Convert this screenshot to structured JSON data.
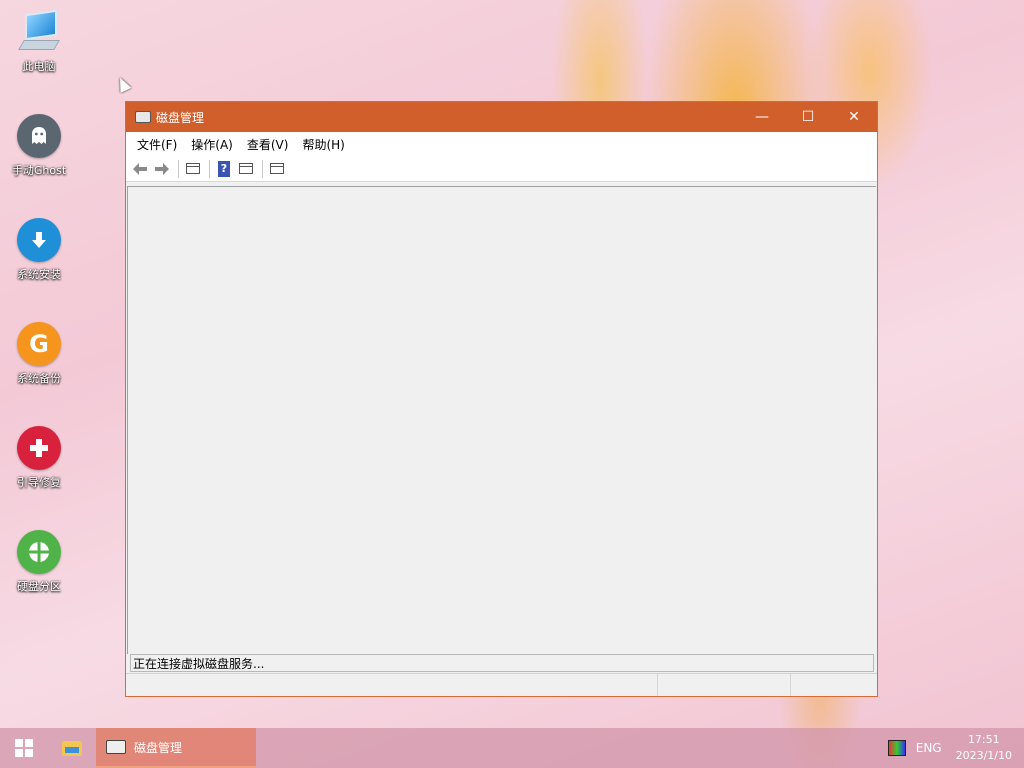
{
  "desktop": {
    "icons": [
      {
        "label": "此电脑",
        "icon": "computer-icon"
      },
      {
        "label": "手动Ghost",
        "icon": "ghost-icon"
      },
      {
        "label": "系统安装",
        "icon": "download-icon"
      },
      {
        "label": "系统备份",
        "icon": "backup-icon"
      },
      {
        "label": "引导修复",
        "icon": "repair-icon"
      },
      {
        "label": "硬盘分区",
        "icon": "partition-icon"
      }
    ]
  },
  "window": {
    "title": "磁盘管理",
    "accent": "#d15f2c",
    "controls": {
      "minimize": "—",
      "maximize": "☐",
      "close": "✕"
    },
    "menu": [
      "文件(F)",
      "操作(A)",
      "查看(V)",
      "帮助(H)"
    ],
    "status_text": "正在连接虚拟磁盘服务..."
  },
  "taskbar": {
    "task_label": "磁盘管理",
    "language": "ENG",
    "time": "17:51",
    "date": "2023/1/10"
  }
}
